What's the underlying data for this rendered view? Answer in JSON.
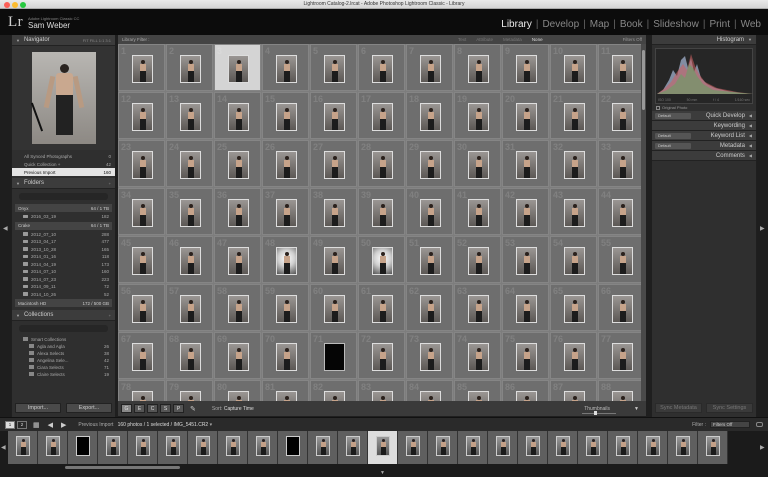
{
  "window": {
    "title": "Lightroom Catalog-2.lrcat - Adobe Photoshop Lightroom Classic - Library",
    "traffic_colors": [
      "#fc5f57",
      "#fdbc2e",
      "#28c840"
    ]
  },
  "identity": {
    "logo": "Lr",
    "app_name": "Adobe Lightroom Classic CC",
    "user": "Sam Weber"
  },
  "modules": [
    {
      "label": "Library",
      "active": true
    },
    {
      "label": "Develop",
      "active": false
    },
    {
      "label": "Map",
      "active": false
    },
    {
      "label": "Book",
      "active": false
    },
    {
      "label": "Slideshow",
      "active": false
    },
    {
      "label": "Print",
      "active": false
    },
    {
      "label": "Web",
      "active": false
    }
  ],
  "navigator": {
    "title": "Navigator",
    "zoom_options": "FIT  FILL  1:1  3:1"
  },
  "catalog": [
    {
      "label": "All Synced Photographs",
      "count": "0",
      "selected": false
    },
    {
      "label": "Quick Collection +",
      "count": "42",
      "selected": false
    },
    {
      "label": "Previous Import",
      "count": "160",
      "selected": true
    }
  ],
  "folders": {
    "title": "Folders",
    "volumes": [
      {
        "name": "Onyx",
        "info": "64 / 1 TB",
        "folders": [
          {
            "name": "2016_03_19",
            "count": "182"
          }
        ]
      },
      {
        "name": "Crake",
        "info": "64 / 1 TB",
        "folders": [
          {
            "name": "2012_07_10",
            "count": "288"
          },
          {
            "name": "2013_04_17",
            "count": "477"
          },
          {
            "name": "2013_10_28",
            "count": "165"
          },
          {
            "name": "2014_01_16",
            "count": "118"
          },
          {
            "name": "2014_04_19",
            "count": "173"
          },
          {
            "name": "2014_07_10",
            "count": "160"
          },
          {
            "name": "2014_07_23",
            "count": "223"
          },
          {
            "name": "2014_09_11",
            "count": "72"
          },
          {
            "name": "2014_10_26",
            "count": "52"
          }
        ]
      },
      {
        "name": "Macintosh HD",
        "info": "172 / 500 GB",
        "folders": []
      }
    ]
  },
  "collections": {
    "title": "Collections",
    "items": [
      {
        "name": "Smart Collections",
        "count": "",
        "parent": true
      },
      {
        "name": "Agla and Agla",
        "count": "26",
        "parent": false
      },
      {
        "name": "Alexa Selects",
        "count": "38",
        "parent": false
      },
      {
        "name": "Angelina Sele...",
        "count": "42",
        "parent": false
      },
      {
        "name": "Ciara Selects",
        "count": "71",
        "parent": false
      },
      {
        "name": "Claire Selects",
        "count": "19",
        "parent": false
      }
    ]
  },
  "left_buttons": {
    "import": "Import...",
    "export": "Export..."
  },
  "filter_bar": {
    "title": "Library Filter :",
    "options": [
      {
        "label": "Text",
        "active": false
      },
      {
        "label": "Attribute",
        "active": false
      },
      {
        "label": "Metadata",
        "active": false
      },
      {
        "label": "None",
        "active": true
      }
    ],
    "right": "Filters Off"
  },
  "grid": {
    "columns": 11,
    "start_number": 1,
    "selected_number": 3,
    "bright_numbers": [
      48,
      50
    ],
    "dark_numbers": [
      71
    ]
  },
  "toolbar": {
    "view_buttons": [
      "G",
      "E",
      "C",
      "S",
      "P"
    ],
    "sort_label": "Sort:",
    "sort_value": "Capture Time",
    "thumbnails_label": "Thumbnails",
    "thumbnail_size": 0.35
  },
  "right_panel": {
    "histogram_title": "Histogram",
    "hist_info": [
      "ISO 100",
      "50 mm",
      "f / 4",
      "1/160 sec"
    ],
    "original_photo": "Original Photo",
    "sections": [
      {
        "label": "Quick Develop",
        "preset": "Default"
      },
      {
        "label": "Keywording",
        "preset": ""
      },
      {
        "label": "Keyword List",
        "preset": "Default"
      },
      {
        "label": "Metadata",
        "preset": "Default"
      },
      {
        "label": "Comments",
        "preset": ""
      }
    ],
    "sync_buttons": {
      "metadata": "Sync Metadata",
      "settings": "Sync Settings"
    }
  },
  "filmbar": {
    "screens": [
      "1",
      "2"
    ],
    "crumb_label": "Previous Import",
    "crumb_info": "160 photos / 1 selected / IMG_5451.CR2",
    "filter_label": "Filter :",
    "filter_value": "Filters Off"
  },
  "filmstrip": {
    "count": 24,
    "selected_index": 12,
    "dark_indexes": [
      2,
      9
    ]
  }
}
